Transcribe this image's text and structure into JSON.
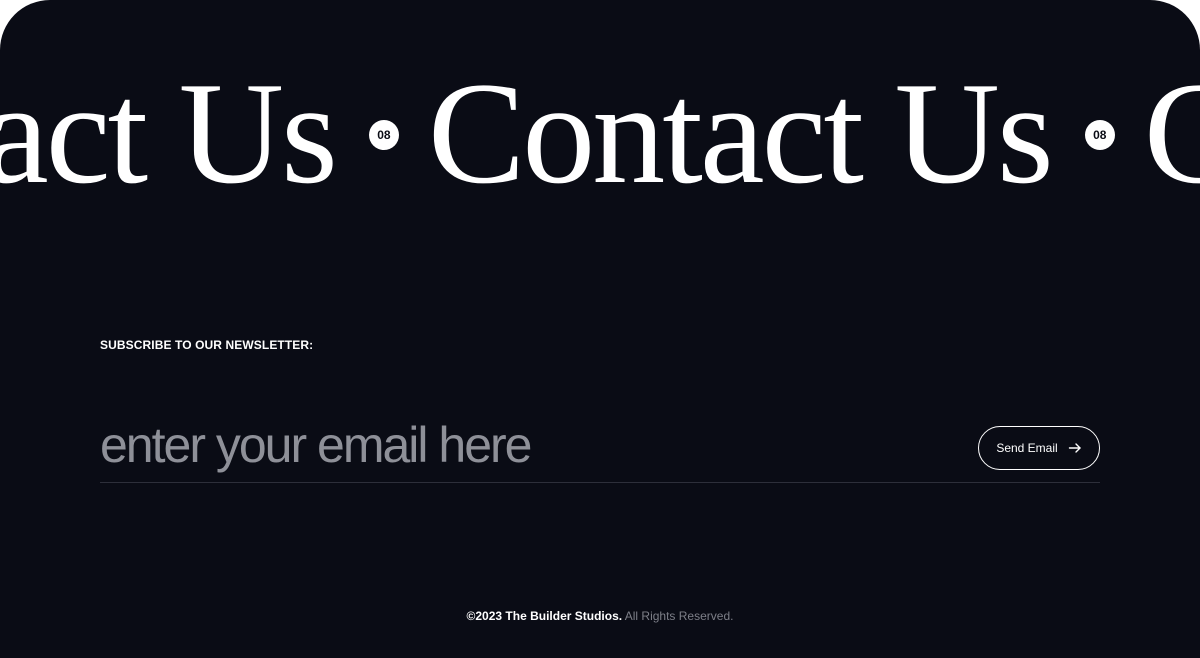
{
  "marquee": {
    "items": [
      {
        "word": "Contact Us",
        "badge": "08"
      },
      {
        "word": "Contact Us",
        "badge": "08"
      },
      {
        "word": "Contact Us",
        "badge": "08"
      }
    ]
  },
  "newsletter": {
    "label": "SUBSCRIBE TO OUR NEWSLETTER:",
    "email_placeholder": "enter your email here",
    "email_value": "",
    "send_label": "Send Email",
    "send_icon": "arrow-right-icon"
  },
  "footer": {
    "copyright": "©2023 The Builder Studios.",
    "rights": "All Rights Reserved."
  },
  "colors": {
    "background": "#0a0c15",
    "text": "#ffffff",
    "placeholder": "#8e9098",
    "muted": "#7d7f88"
  }
}
